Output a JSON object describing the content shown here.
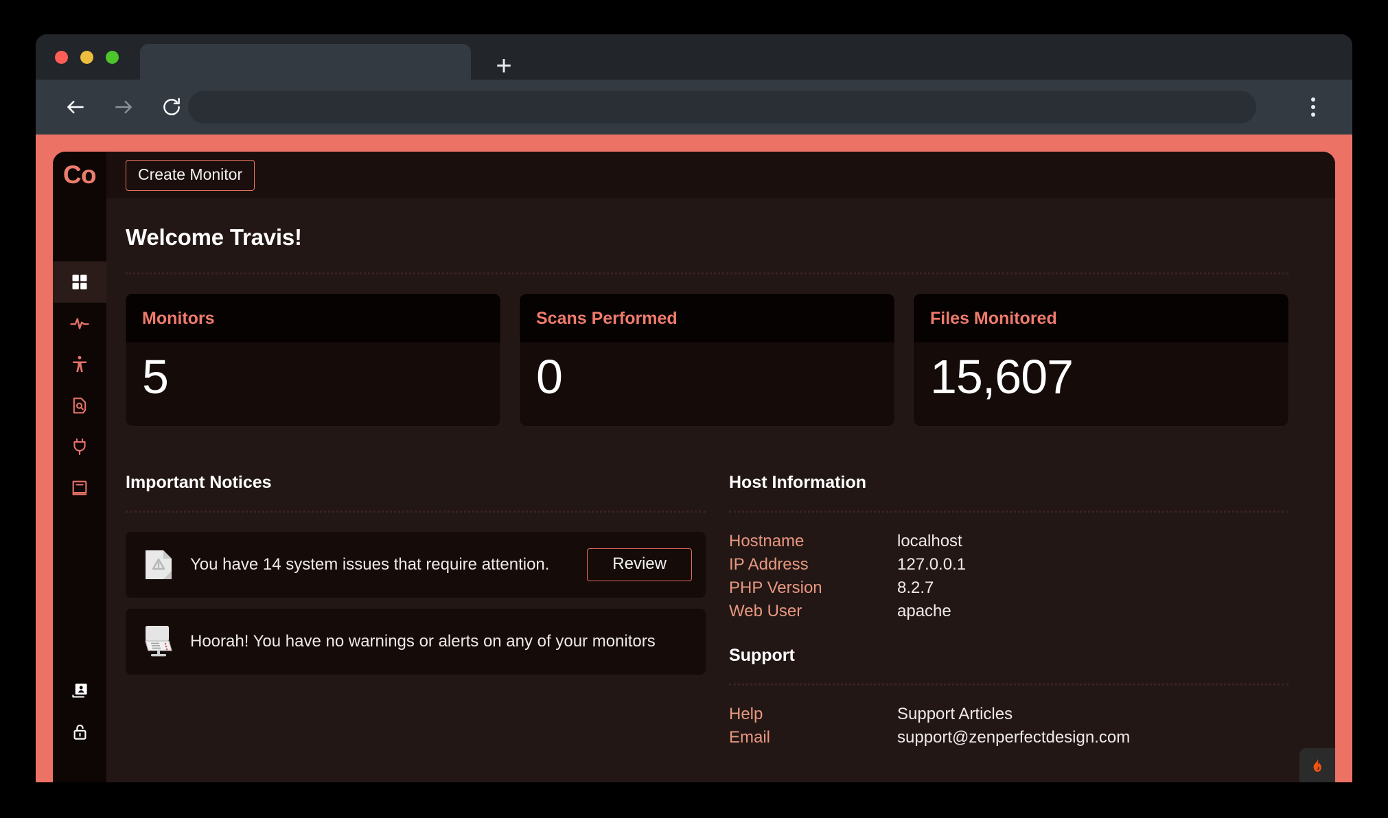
{
  "browser": {
    "tab_title": "",
    "address_value": "",
    "back_icon": "arrow-left-icon",
    "forward_icon": "arrow-right-icon",
    "reload_icon": "reload-icon",
    "new_tab_label": "+",
    "menu_icon": "kebab-menu-icon"
  },
  "app": {
    "logo_text": "Co",
    "accent": "#ec7266",
    "topbar": {
      "create_monitor_label": "Create Monitor"
    },
    "sidebar": {
      "items": [
        {
          "name": "dashboard",
          "icon": "grid-dashboard-icon",
          "active": true
        },
        {
          "name": "activity",
          "icon": "pulse-activity-icon",
          "active": false
        },
        {
          "name": "accessibility",
          "icon": "person-accessibility-icon",
          "active": false
        },
        {
          "name": "scan-report",
          "icon": "document-search-icon",
          "active": false
        },
        {
          "name": "integrations",
          "icon": "plug-icon",
          "active": false
        },
        {
          "name": "docs",
          "icon": "book-icon",
          "active": false
        }
      ],
      "bottom_items": [
        {
          "name": "account",
          "icon": "user-card-icon"
        },
        {
          "name": "logout",
          "icon": "unlock-icon"
        }
      ]
    },
    "page_title": "Welcome Travis!",
    "stats": [
      {
        "title": "Monitors",
        "value": "5"
      },
      {
        "title": "Scans Performed",
        "value": "0"
      },
      {
        "title": "Files Monitored",
        "value": "15,607"
      }
    ],
    "notices": {
      "title": "Important Notices",
      "items": [
        {
          "icon": "document-warning-icon",
          "text": "You have 14 system issues that require attention.",
          "action_label": "Review"
        },
        {
          "icon": "server-monitor-icon",
          "text": "Hoorah! You have no warnings or alerts on any of your monitors",
          "action_label": ""
        }
      ]
    },
    "host_information": {
      "title": "Host Information",
      "rows": [
        {
          "key": "Hostname",
          "value": "localhost"
        },
        {
          "key": "IP Address",
          "value": "127.0.0.1"
        },
        {
          "key": "PHP Version",
          "value": "8.2.7"
        },
        {
          "key": "Web User",
          "value": "apache"
        }
      ]
    },
    "support": {
      "title": "Support",
      "rows": [
        {
          "key": "Help",
          "value": "Support Articles"
        },
        {
          "key": "Email",
          "value": "support@zenperfectdesign.com"
        }
      ]
    },
    "debug_badge": {
      "icon": "flame-icon"
    }
  }
}
